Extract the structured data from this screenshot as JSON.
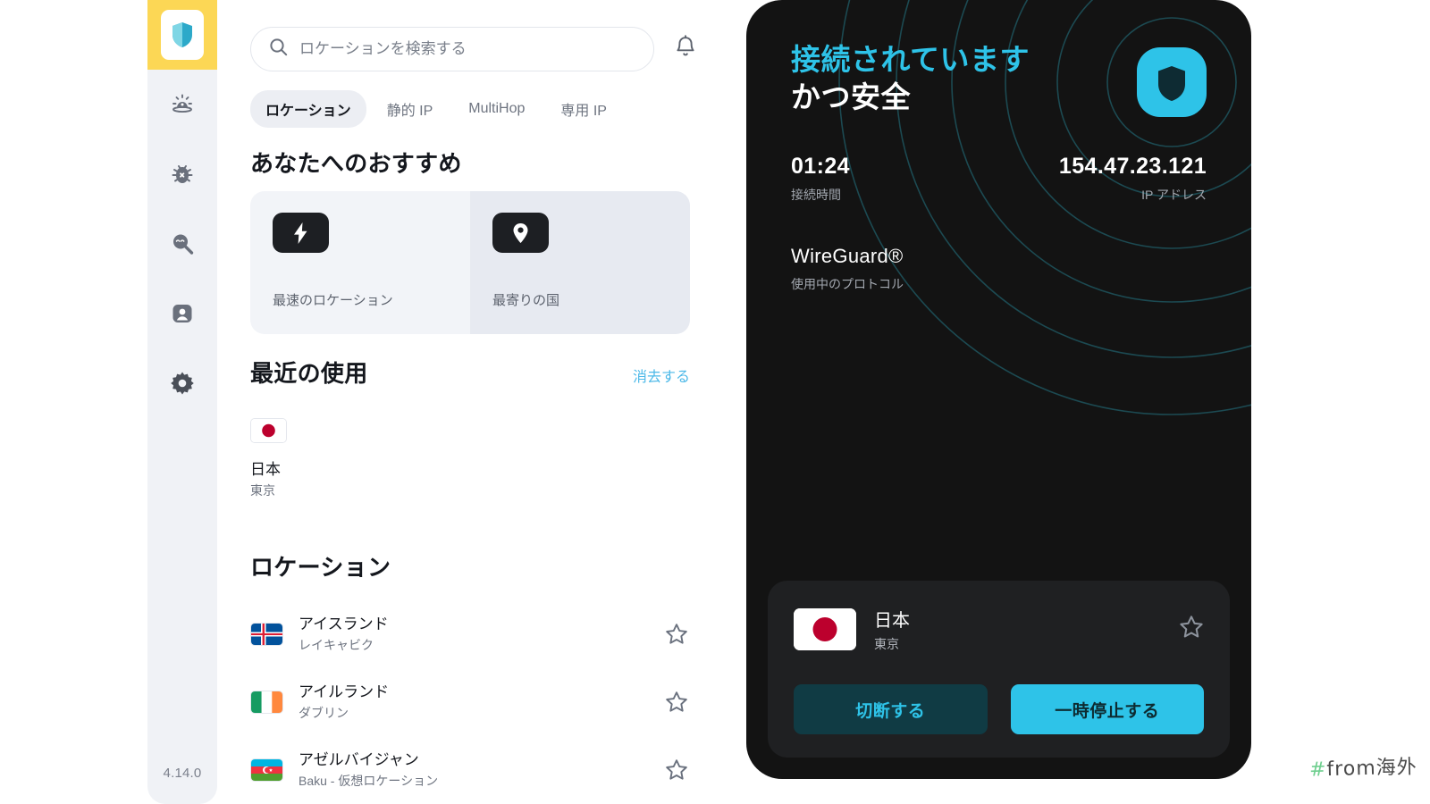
{
  "app": {
    "version": "4.14.0",
    "brand_color": "#2ec3e8",
    "accent_yellow": "#fcd755"
  },
  "sidebar": {
    "items": [
      {
        "icon": "shield-logo-icon",
        "name": "vpn",
        "active": true
      },
      {
        "icon": "threat-alert-icon",
        "name": "threat-protection",
        "active": false
      },
      {
        "icon": "bug-shield-icon",
        "name": "malware-protection",
        "active": false
      },
      {
        "icon": "dark-web-monitor-icon",
        "name": "dark-web-monitor",
        "active": false
      },
      {
        "icon": "profile-card-icon",
        "name": "account",
        "active": false
      },
      {
        "icon": "gear-icon",
        "name": "settings",
        "active": false
      }
    ]
  },
  "search": {
    "placeholder": "ロケーションを検索する",
    "value": "",
    "icon": "search-icon"
  },
  "notifications": {
    "icon": "bell-icon"
  },
  "tabs": [
    {
      "label": "ロケーション",
      "active": true
    },
    {
      "label": "静的 IP",
      "active": false
    },
    {
      "label": "MultiHop",
      "active": false
    },
    {
      "label": "専用 IP",
      "active": false
    }
  ],
  "recommended": {
    "title": "あなたへのおすすめ",
    "cards": [
      {
        "label": "最速のロケーション",
        "icon": "lightning-bolt-icon"
      },
      {
        "label": "最寄りの国",
        "icon": "map-pin-icon"
      }
    ]
  },
  "recent": {
    "title": "最近の使用",
    "clear_label": "消去する",
    "items": [
      {
        "country": "日本",
        "city": "東京",
        "flag": "jp"
      }
    ]
  },
  "locations": {
    "title": "ロケーション",
    "items": [
      {
        "country": "アイスランド",
        "city": "レイキャビク",
        "flag": "is",
        "favorite": false
      },
      {
        "country": "アイルランド",
        "city": "ダブリン",
        "flag": "ie",
        "favorite": false
      },
      {
        "country": "アゼルバイジャン",
        "city": "Baku - 仮想ロケーション",
        "flag": "az",
        "favorite": false
      }
    ]
  },
  "panel": {
    "status_line1": "接続されています",
    "status_line2": "かつ安全",
    "connection_time": {
      "value": "01:24",
      "label": "接続時間"
    },
    "ip_address": {
      "value": "154.47.23.121",
      "label": "IP アドレス"
    },
    "protocol": {
      "value": "WireGuard®",
      "label": "使用中のプロトコル"
    },
    "badge_icon": "shield-badge-icon",
    "connection_card": {
      "country": "日本",
      "city": "東京",
      "flag": "jp",
      "star_icon": "star-outline-icon",
      "disconnect_label": "切断する",
      "pause_label": "一時停止する"
    }
  },
  "watermark": {
    "hash": "#",
    "text": "from海外"
  }
}
